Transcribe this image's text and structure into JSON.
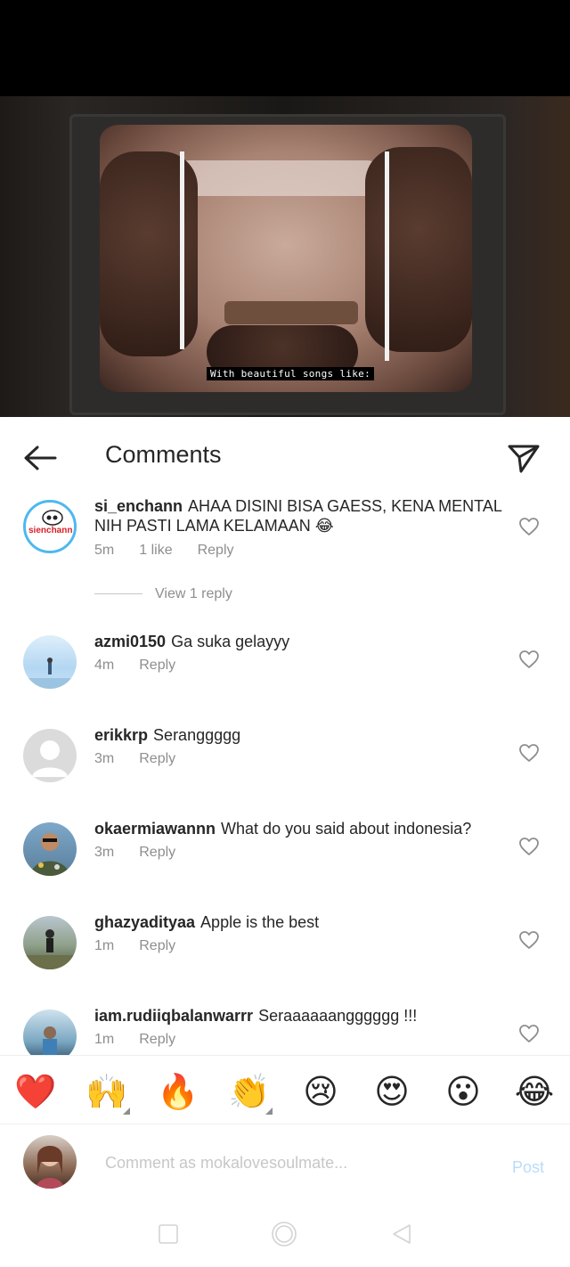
{
  "video": {
    "subtitle": "With beautiful songs like:"
  },
  "header": {
    "title": "Comments",
    "back_icon": "arrow-left-icon",
    "share_icon": "paper-plane-icon"
  },
  "comments": [
    {
      "username": "si_enchann",
      "text": "AHAA DISINI BISA GAESS, KENA MENTAL NIH PASTI LAMA KELAMAAN 😂",
      "time": "5m",
      "likes": "1 like",
      "reply": "Reply",
      "view_replies": "View 1 reply",
      "avatar_text": "sienchann"
    },
    {
      "username": "azmi0150",
      "text": "Ga suka gelayyy",
      "time": "4m",
      "reply": "Reply"
    },
    {
      "username": "erikkrp",
      "text": "Seranggggg",
      "time": "3m",
      "reply": "Reply"
    },
    {
      "username": "okaermiawannn",
      "text": "What do you said about indonesia?",
      "time": "3m",
      "reply": "Reply"
    },
    {
      "username": "ghazyadityaa",
      "text": "Apple is the best",
      "time": "1m",
      "reply": "Reply"
    },
    {
      "username": "iam.rudiiqbalanwarrr",
      "text": "Seraaaaaangggggg !!!",
      "time": "1m",
      "reply": "Reply"
    }
  ],
  "emoji_bar": [
    "❤️",
    "🙌",
    "🔥",
    "👏",
    "😢",
    "😍",
    "😮",
    "😂"
  ],
  "composer": {
    "placeholder": "Comment as mokalovesoulmate...",
    "post_label": "Post"
  },
  "colors": {
    "text": "#262626",
    "meta": "#8e8e8e",
    "post_disabled": "#b9dcf8"
  }
}
